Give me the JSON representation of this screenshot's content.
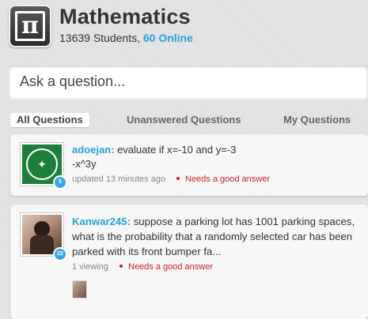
{
  "subject": {
    "logo_symbol": "π",
    "title": "Mathematics",
    "students_text": "13639 Students, ",
    "online_text": "60 Online"
  },
  "ask": {
    "placeholder": "Ask a question..."
  },
  "tabs": [
    {
      "label": "All Questions",
      "active": true
    },
    {
      "label": "Unanswered Questions",
      "active": false
    },
    {
      "label": "My Questions",
      "active": false
    }
  ],
  "questions": [
    {
      "user": "adoejan:",
      "line1": " evaluate if x=-10 and y=-3",
      "line2": "-x^3y",
      "badge": "5",
      "meta": "updated 13 minutes ago",
      "status": "Needs a good answer",
      "avatar_icon": "school-logo-avatar"
    },
    {
      "user": "Kanwar245:",
      "text": " suppose a parking lot has 1001 parking spaces, what is the probability that a randomly selected car has been parked with its front bumper fa...",
      "badge": "22",
      "meta": "1 viewing",
      "status": "Needs a good answer",
      "avatar_icon": "user-photo-avatar"
    }
  ],
  "colors": {
    "accent": "#2aa1d9",
    "warning": "#d11f1f",
    "badge": "#3aa6e6"
  }
}
